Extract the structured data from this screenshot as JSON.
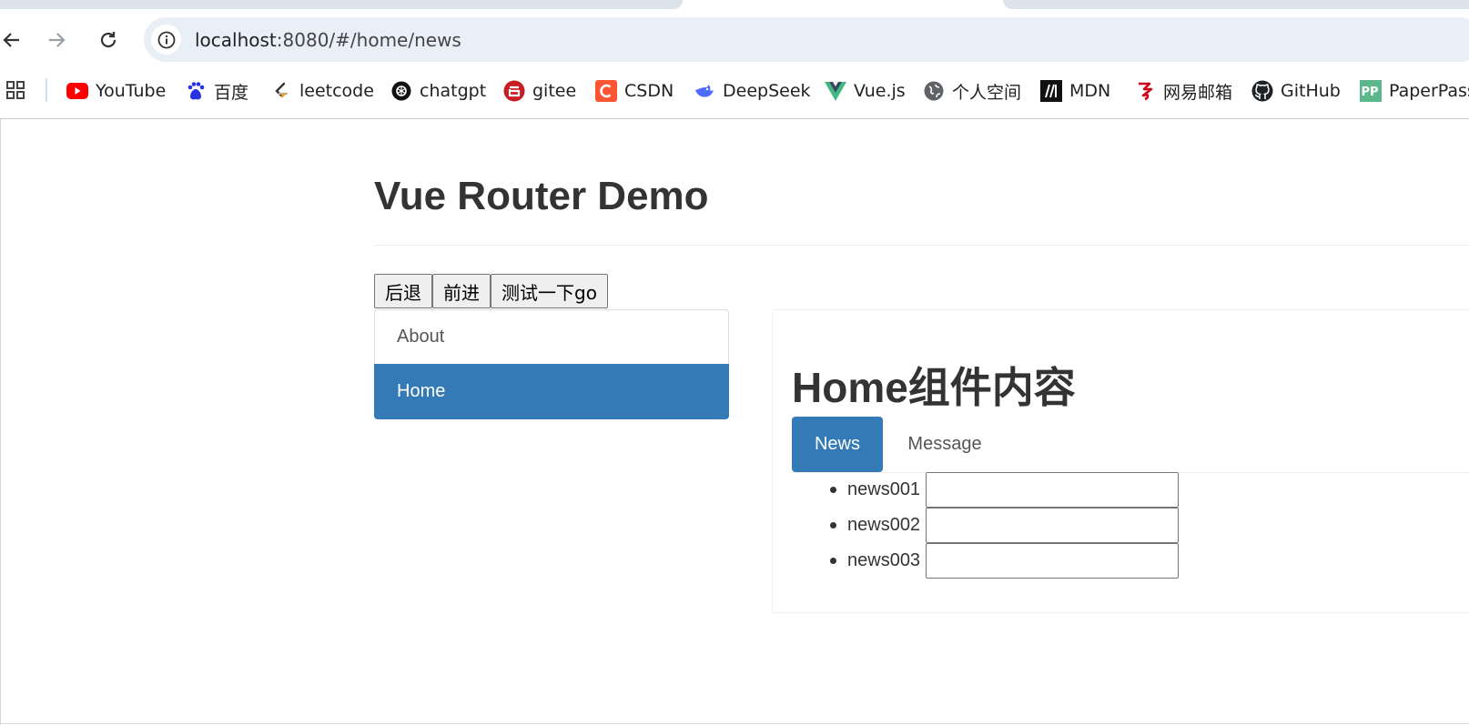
{
  "browser": {
    "url_host": "localhost",
    "url_path": ":8080/#/home/news",
    "bookmarks": [
      {
        "label": "YouTube",
        "icon": "youtube-icon"
      },
      {
        "label": "百度",
        "icon": "baidu-icon"
      },
      {
        "label": "leetcode",
        "icon": "leetcode-icon"
      },
      {
        "label": "chatgpt",
        "icon": "chatgpt-icon"
      },
      {
        "label": "gitee",
        "icon": "gitee-icon"
      },
      {
        "label": "CSDN",
        "icon": "csdn-icon"
      },
      {
        "label": "DeepSeek",
        "icon": "deepseek-icon"
      },
      {
        "label": "Vue.js",
        "icon": "vue-icon"
      },
      {
        "label": "个人空间",
        "icon": "globe-icon"
      },
      {
        "label": "MDN",
        "icon": "mdn-icon"
      },
      {
        "label": "网易邮箱",
        "icon": "netease-mail-icon"
      },
      {
        "label": "GitHub",
        "icon": "github-icon"
      },
      {
        "label": "PaperPass",
        "icon": "paperpass-icon"
      }
    ]
  },
  "page": {
    "title": "Vue Router Demo",
    "buttons": {
      "back": "后退",
      "forward": "前进",
      "go": "测试一下go"
    },
    "nav": [
      {
        "label": "About",
        "active": false
      },
      {
        "label": "Home",
        "active": true
      }
    ],
    "home": {
      "title": "Home组件内容",
      "tabs": [
        {
          "label": "News",
          "active": true
        },
        {
          "label": "Message",
          "active": false
        }
      ],
      "news": [
        {
          "label": "news001",
          "value": ""
        },
        {
          "label": "news002",
          "value": ""
        },
        {
          "label": "news003",
          "value": ""
        }
      ]
    }
  },
  "colors": {
    "primary": "#337ab7",
    "omnibox": "#e9eff7"
  }
}
